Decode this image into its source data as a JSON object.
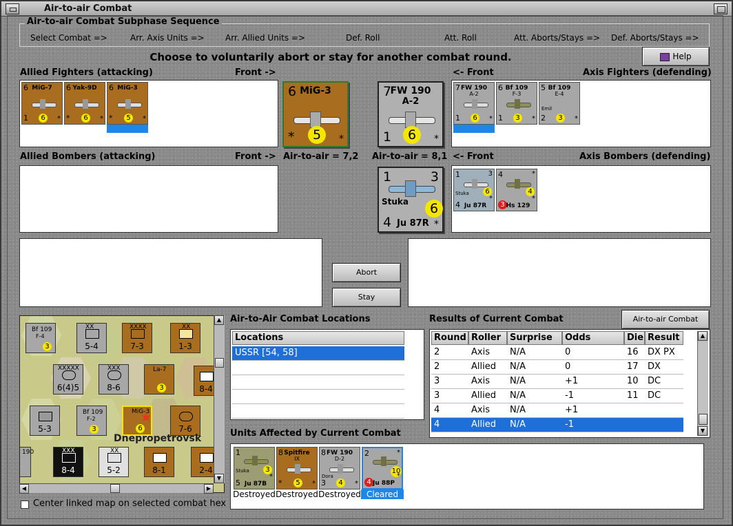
{
  "window": {
    "title": "Air-to-air Combat"
  },
  "sequence": {
    "title": "Air-to-air Combat Subphase Sequence",
    "steps": [
      "Select Combat =>",
      "Arr. Axis Units =>",
      "Arr. Allied Units =>",
      "Def. Roll",
      "Att. Roll",
      "Att. Aborts/Stays =>",
      "Def. Aborts/Stays =>"
    ]
  },
  "instruction": "Choose to voluntarily abort or stay for another combat round.",
  "help_label": "Help",
  "allied_fighters": {
    "label": "Allied Fighters (attacking)",
    "front": "Front ->",
    "units": [
      {
        "top": "6",
        "name": "MiG-7",
        "bottom": "1",
        "dot": "6",
        "star": "*"
      },
      {
        "top": "6",
        "name": "Yak-9D",
        "bottom": "*",
        "dot": "6",
        "star": "*"
      },
      {
        "top": "6",
        "name": "MiG-3",
        "bottom": "*",
        "dot": "5",
        "star": "*"
      }
    ]
  },
  "axis_fighters": {
    "label": "Axis Fighters (defending)",
    "front": "<- Front",
    "units": [
      {
        "top": "7",
        "name": "FW 190",
        "sub": "A-2",
        "bottom": "1",
        "dot": "6",
        "star": "*"
      },
      {
        "top": "6",
        "name": "Bf 109",
        "sub": "F-3",
        "bottom": "1",
        "dot": "3",
        "star": "*"
      },
      {
        "top": "5",
        "name": "Bf 109",
        "sub": "E-4",
        "extra": "Emil",
        "bottom": "2",
        "dot": "3",
        "star": "*"
      }
    ]
  },
  "allied_bombers": {
    "label": "Allied Bombers (attacking)",
    "front": "Front ->"
  },
  "axis_bombers": {
    "label": "Axis Bombers (defending)",
    "front": "<- Front",
    "units": [
      {
        "top": "1",
        "tr": "3",
        "name": "Stuka",
        "bottom": "4",
        "bname": "Ju 87R",
        "dot": "6",
        "star": "*"
      },
      {
        "top": "4",
        "tr": "*",
        "bottom": "3",
        "bname": "Hs 129",
        "dot": "4",
        "star": "*"
      }
    ]
  },
  "big_allied": {
    "top": "6",
    "name": "MiG-3",
    "bottom": "*",
    "dot": "5",
    "star": "*",
    "air_to_air": "Air-to-air = 7,2"
  },
  "big_axis_fighter": {
    "top": "7",
    "name": "FW 190",
    "sub": "A-2",
    "bottom": "1",
    "dot": "6",
    "star": "*",
    "air_to_air": "Air-to-air = 8,1"
  },
  "big_axis_bomber": {
    "top": "1",
    "tr": "3",
    "name": "Stuka",
    "bottom": "4",
    "bname": "Ju 87R",
    "dot": "6",
    "star": "*"
  },
  "abort_label": "Abort",
  "stay_label": "Stay",
  "map": {
    "counters": [
      {
        "name": "Bf 109",
        "sub": "F-4",
        "dot": "3"
      },
      {
        "label": "XX",
        "value": "5-4"
      },
      {
        "label": "XXXX",
        "value": "7-3"
      },
      {
        "label": "XX",
        "value": "1-3"
      },
      {
        "label": "XXXXX",
        "value": "6(4)5"
      },
      {
        "label": "XXX",
        "value": "8-6"
      },
      {
        "name": "La-7",
        "dot": "3"
      },
      {
        "value": "5-3"
      },
      {
        "name": "Bf 109",
        "sub": "F-2",
        "dot": "3"
      },
      {
        "name": "MiG-3",
        "dot": "6"
      },
      {
        "value": "7-6"
      },
      {
        "label": "XXX",
        "value": "8-4"
      },
      {
        "label": "XX",
        "value": "5-2"
      },
      {
        "value": "8-1"
      },
      {
        "value": "2-4"
      },
      {
        "value": "8-4"
      },
      {
        "value": "190"
      }
    ],
    "place": "Dnepropetrovsk"
  },
  "locations": {
    "title": "Air-to-Air Combat Locations",
    "header": "Locations",
    "rows": [
      "USSR [54, 58]"
    ]
  },
  "results": {
    "title": "Results of Current Combat",
    "chart_button": "Air-to-air Combat Chart",
    "columns": [
      "Round",
      "Roller",
      "Surprise",
      "Odds",
      "Die",
      "Result"
    ],
    "rows": [
      [
        "2",
        "Axis",
        "N/A",
        "0",
        "16",
        "DX PX"
      ],
      [
        "2",
        "Allied",
        "N/A",
        "0",
        "17",
        "DX"
      ],
      [
        "3",
        "Axis",
        "N/A",
        "+1",
        "10",
        "DC"
      ],
      [
        "3",
        "Allied",
        "N/A",
        "-1",
        "11",
        "DC"
      ],
      [
        "4",
        "Axis",
        "N/A",
        "+1",
        "",
        ""
      ],
      [
        "4",
        "Allied",
        "N/A",
        "-1",
        "",
        ""
      ]
    ]
  },
  "affected": {
    "title": "Units Affected by Current Combat",
    "units": [
      {
        "top": "1",
        "name": "Stuka",
        "bottom": "5",
        "bname": "Ju 87B",
        "dot": "3",
        "star": "*",
        "caption": "Destroyed"
      },
      {
        "top": "8",
        "name": "Spitfire",
        "sub": "IX",
        "bottom": "*",
        "dot": "5",
        "star": "*",
        "caption": "Destroyed"
      },
      {
        "top": "8",
        "name": "FW 190",
        "sub": "D-2",
        "extra": "Dora",
        "bottom": "3",
        "dot": "4",
        "star": "*",
        "caption": "Destroyed"
      },
      {
        "top": "2",
        "tr": "*",
        "bottom": "4",
        "bname": "Ju 88P",
        "dot": "10",
        "star": "*",
        "caption": "Cleared"
      }
    ]
  },
  "center_map_label": "Center linked map on selected combat hex"
}
